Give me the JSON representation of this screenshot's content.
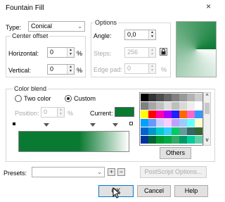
{
  "window": {
    "title": "Fountain Fill",
    "close_glyph": "×"
  },
  "type": {
    "label": "Type:",
    "value": "Conical",
    "arrow": "⌄"
  },
  "center_offset": {
    "legend": "Center offset",
    "horizontal": {
      "label": "Horizontal:",
      "value": "0",
      "unit": "%"
    },
    "vertical": {
      "label": "Vertical:",
      "value": "0",
      "unit": "%"
    }
  },
  "options": {
    "legend": "Options",
    "angle": {
      "label": "Angle:",
      "value": "0,0"
    },
    "steps": {
      "label": "Steps:",
      "value": "256"
    },
    "edge_pad": {
      "label": "Edge pad:",
      "value": "0",
      "unit": "%"
    }
  },
  "color_blend": {
    "legend": "Color blend",
    "two_color": {
      "label": "Two color",
      "selected": false
    },
    "custom": {
      "label": "Custom",
      "selected": true
    },
    "position": {
      "label": "Position:",
      "value": "0",
      "unit": "%"
    },
    "current_label": "Current:",
    "current_color": "#0a7a32",
    "others_label": "Others"
  },
  "presets": {
    "label": "Presets:",
    "value": "",
    "add_glyph": "+",
    "remove_glyph": "−",
    "postscript_label": "PostScript Options..."
  },
  "footer": {
    "ok_label": "OK",
    "cancel_label": "Cancel",
    "help_label": "Help"
  },
  "colors": {
    "accent": "#0078d7",
    "gradient_dark": "#0a7a32",
    "gradient_light": "#ffffff"
  },
  "palette": {
    "rows": [
      [
        "#000000",
        "#333333",
        "#4d4d4d",
        "#666666",
        "#808080",
        "#999999",
        "#b3b3b3",
        "#cccccc"
      ],
      [
        "#808080",
        "#a6a6a6",
        "#c0c0c0",
        "#dddddd",
        "#bfbfbf",
        "#d9d9d9",
        "#eeeeee",
        "#ffffff"
      ],
      [
        "#ffff00",
        "#ff0000",
        "#ff00aa",
        "#aa00ff",
        "#2020ff",
        "#ff6600",
        "#ff66cc",
        "#3399ff"
      ],
      [
        "#00a0ff",
        "#6699ff",
        "#ccccff",
        "#ffccff",
        "#c0a0ff",
        "#99ccff",
        "#66ffff",
        "#ffffcc"
      ],
      [
        "#0066cc",
        "#0099cc",
        "#00cccc",
        "#33ccff",
        "#00cc66",
        "#669999",
        "#336666",
        "#336633"
      ],
      [
        "#003399",
        "#006633",
        "#009933",
        "#00aa44",
        "#33aa66",
        "#009966",
        "#00cc99",
        "#66ccaa"
      ]
    ],
    "scroll_up": "^",
    "scroll_down": "v"
  }
}
